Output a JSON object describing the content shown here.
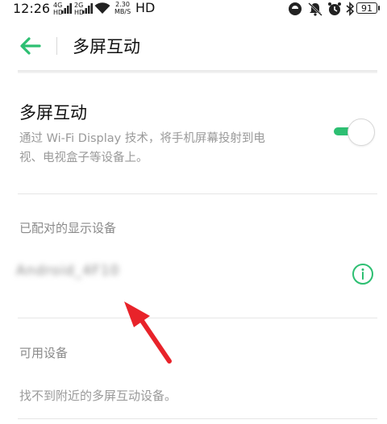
{
  "status_bar": {
    "time": "12:26",
    "sim1_tech": "4G",
    "sim1_sub": "HD",
    "sim2_tech": "2G",
    "sim2_sub": "HD",
    "net_speed_value": "2.30",
    "net_speed_unit": "MB/S",
    "hd_label": "HD",
    "battery_level": "91"
  },
  "header": {
    "title": "多屏互动"
  },
  "setting": {
    "title": "多屏互动",
    "description_line1": "通过 Wi-Fi Display 技术，将手机屏幕投射到电",
    "description_line2": "视、电视盒子等设备上。",
    "enabled": true
  },
  "paired_section": {
    "header": "已配对的显示设备",
    "device_name": "Android_4F10"
  },
  "available_section": {
    "header": "可用设备",
    "empty_text": "找不到附近的多屏互动设备。"
  },
  "colors": {
    "accent": "#2dbf72",
    "annotation_arrow": "#e8232a"
  },
  "icons": {
    "back": "arrow-left-icon",
    "info": "info-circle-icon"
  }
}
